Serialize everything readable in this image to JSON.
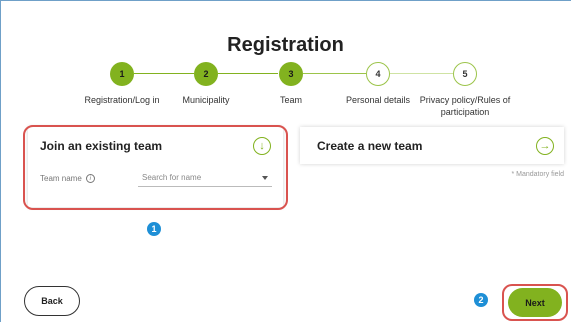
{
  "page": {
    "title": "Registration"
  },
  "steps": [
    {
      "number": "1",
      "label": "Registration/Log in",
      "state": "done"
    },
    {
      "number": "2",
      "label": "Municipality",
      "state": "done"
    },
    {
      "number": "3",
      "label": "Team",
      "state": "done"
    },
    {
      "number": "4",
      "label": "Personal details",
      "state": "todo"
    },
    {
      "number": "5",
      "label": "Privacy policy/Rules of participation",
      "state": "todo"
    }
  ],
  "join_card": {
    "title": "Join an existing team",
    "icon": "arrow-down-circle-icon",
    "field_label": "Team name",
    "select_placeholder": "Search for name"
  },
  "create_card": {
    "title": "Create a new team",
    "icon": "arrow-right-circle-icon"
  },
  "mandatory_note": "* Mandatory field",
  "annotations": {
    "badge_1": "1",
    "badge_2": "2"
  },
  "buttons": {
    "back": "Back",
    "next": "Next"
  },
  "colors": {
    "accent_green": "#82b21f",
    "highlight_red": "#d9534f",
    "badge_blue": "#1e8fd6"
  }
}
